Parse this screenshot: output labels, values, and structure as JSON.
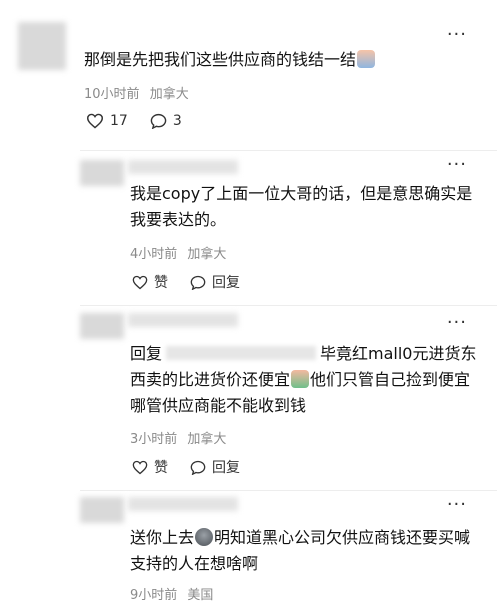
{
  "comments": [
    {
      "text": "那倒是先把我们这些供应商的钱结一结",
      "time": "10小时前",
      "location": "加拿大",
      "likes": "17",
      "replies": "3"
    },
    {
      "text": "我是copy了上面一位大哥的话，但是意思确实是我要表达的。",
      "time": "4小时前",
      "location": "加拿大",
      "like_label": "赞",
      "reply_label": "回复"
    },
    {
      "reply_prefix": "回复",
      "text_a": "毕竟红mall0元进货东西卖的比进货价还便宜",
      "text_b": "他们只管自己捡到便宜哪管供应商能不能收到钱",
      "time": "3小时前",
      "location": "加拿大",
      "like_label": "赞",
      "reply_label": "回复"
    },
    {
      "text_a": "送你上去",
      "text_b": "明知道黑心公司欠供应商钱还要买喊支持的人在想啥啊",
      "time": "9小时前",
      "location": "美国"
    }
  ],
  "icons": {
    "more": "more-dots-icon",
    "heart": "heart-icon",
    "chat": "comment-bubble-icon"
  }
}
